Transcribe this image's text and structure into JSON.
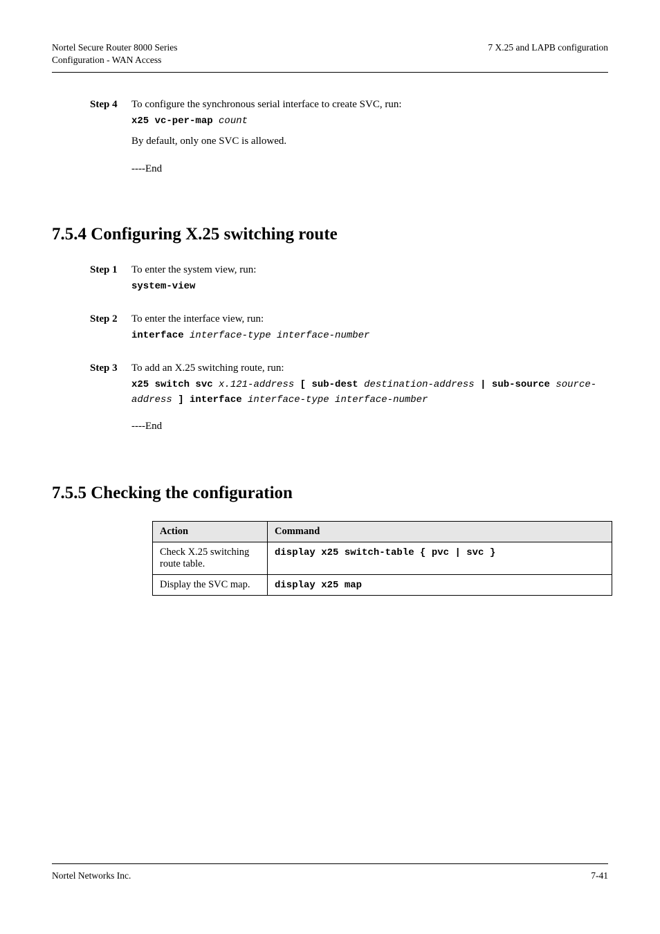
{
  "header": {
    "left_line1": "Nortel Secure Router 8000 Series",
    "left_line2": "Configuration - WAN Access",
    "right_line1": "7 X.25 and LAPB configuration",
    "right_line2_invisible": true
  },
  "footer": {
    "left": "Nortel Networks Inc.",
    "right": "7-41"
  },
  "top_step": {
    "label": "Step 4",
    "desc": "To configure the synchronous serial interface to create SVC, run:",
    "primary_cmd_html": "x25 vc-per-map <span class='arg'>count</span>",
    "note": "By default, only one SVC is allowed.",
    "end": "----End"
  },
  "section754": {
    "heading": "7.5.4 Configuring X.25 switching route",
    "steps": [
      {
        "label": "Step 1",
        "desc": "To enter the system view, run:",
        "cmd_html": "system-view"
      },
      {
        "label": "Step 2",
        "desc": "To enter the interface view, run:",
        "cmd_html": "interface <span class='arg'>interface-type interface-number</span>"
      },
      {
        "label": "Step 3",
        "desc": "To add an X.25 switching route, run:",
        "cmd_html": "x25 switch svc <span class='arg'>x.121-address</span> [ sub-dest <span class='arg'>destination-address</span> | sub-source <span class='arg'>source-address</span> ] interface <span class='arg'>interface-type interface-number</span>"
      }
    ],
    "end": "----End"
  },
  "section755": {
    "heading": "7.5.5 Checking the configuration",
    "table": {
      "headers": [
        "Action",
        "Command"
      ],
      "rows": [
        {
          "action": "Check X.25 switching route table.",
          "command_html": "display x25 switch-table { pvc | svc }"
        },
        {
          "action": "Display the SVC map.",
          "command_html": "display x25 map"
        }
      ]
    }
  }
}
